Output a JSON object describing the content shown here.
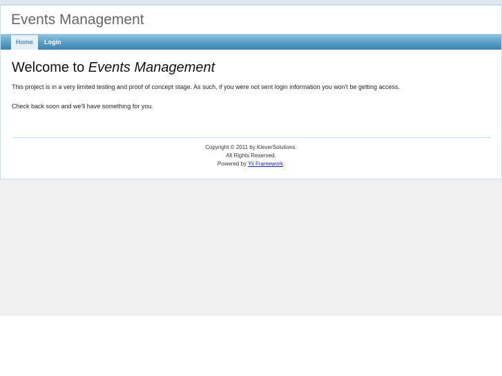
{
  "header": {
    "logo": "Events Management"
  },
  "mainmenu": {
    "items": [
      {
        "label": "Home",
        "active": true
      },
      {
        "label": "Login",
        "active": false
      }
    ]
  },
  "content": {
    "heading_prefix": "Welcome to ",
    "heading_emphasis": "Events Management",
    "paragraph_1": "This project is in a very limited testing and proof of concept stage. As such, if you were not sent login information you won't be getting access.",
    "paragraph_2": "Check back soon and we'll have something for you."
  },
  "footer": {
    "copyright": "Copyright © 2011 by KleverSolutions.",
    "rights": "All Rights Reserved.",
    "powered_prefix": "Powered by ",
    "powered_link": "Yii Framework",
    "powered_suffix": "."
  },
  "colors": {
    "menu_top": "#8ec3de",
    "menu_bottom": "#3f83b0",
    "menu_active_bg": "#e5f0f7",
    "link": "#1a1aa6",
    "page_bg": "#efefef"
  }
}
